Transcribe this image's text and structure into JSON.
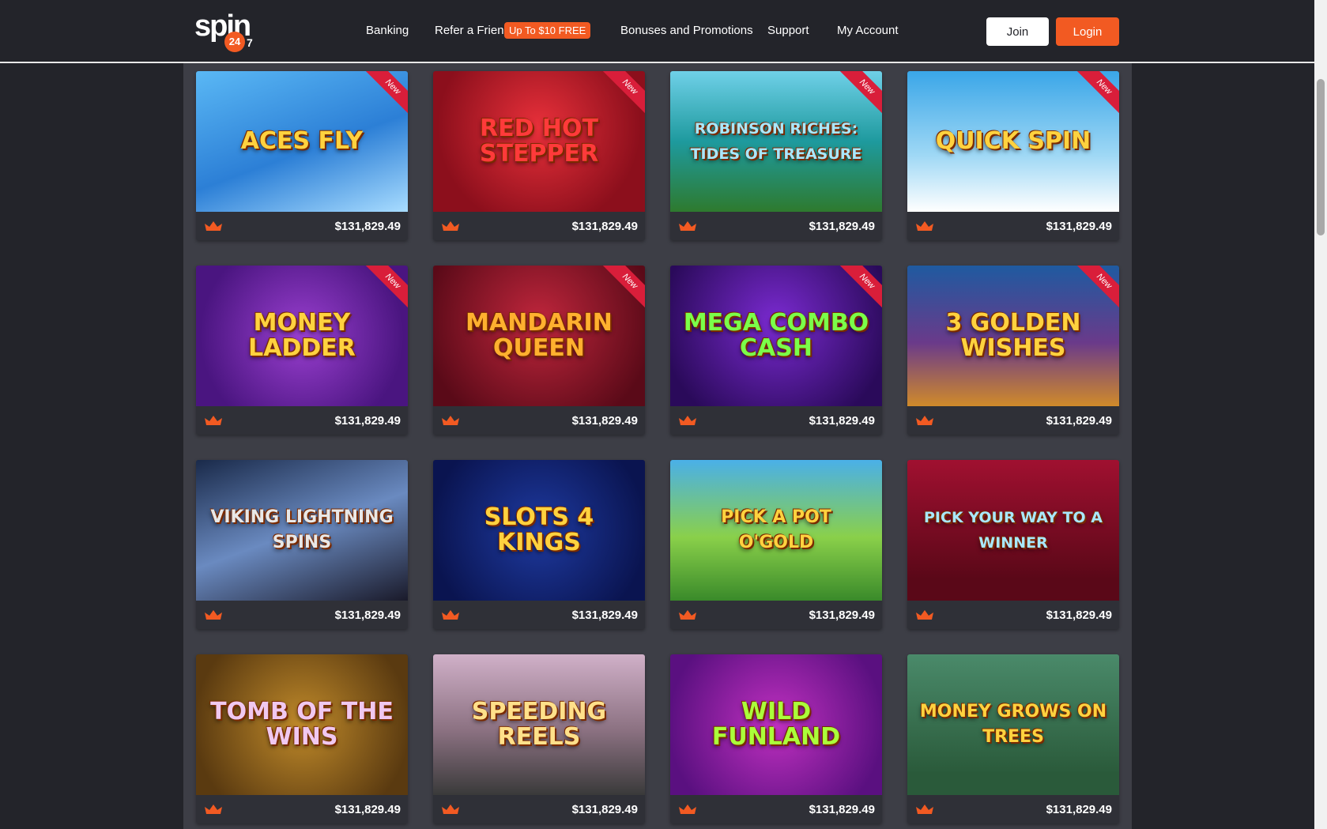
{
  "header": {
    "logo_text": "spin",
    "logo_badge": "24",
    "logo_suffix": "7",
    "nav": {
      "banking": "Banking",
      "refer": "Refer a Friend",
      "refer_promo": "Up To $10 FREE",
      "bonuses": "Bonuses and Promotions",
      "support": "Support",
      "account": "My Account"
    },
    "join_label": "Join",
    "login_label": "Login"
  },
  "colors": {
    "accent": "#f25a22",
    "background": "#23242a",
    "panel": "#3d3e46",
    "ribbon": "#d91e3a"
  },
  "games": [
    {
      "title": "ACES FLY",
      "jackpot": "$131,829.49",
      "badge": "New",
      "icon": "crown-icon"
    },
    {
      "title": "RED HOT STEPPER",
      "jackpot": "$131,829.49",
      "badge": "New",
      "icon": "crown-icon"
    },
    {
      "title": "ROBINSON RICHES: TIDES OF TREASURE",
      "jackpot": "$131,829.49",
      "badge": "New",
      "icon": "crown-icon"
    },
    {
      "title": "QUICK SPIN",
      "jackpot": "$131,829.49",
      "badge": "New",
      "icon": "crown-icon"
    },
    {
      "title": "MONEY LADDER",
      "jackpot": "$131,829.49",
      "badge": "New",
      "icon": "crown-icon"
    },
    {
      "title": "MANDARIN QUEEN",
      "jackpot": "$131,829.49",
      "badge": "New",
      "icon": "crown-icon"
    },
    {
      "title": "MEGA COMBO CASH",
      "jackpot": "$131,829.49",
      "badge": "New",
      "icon": "crown-icon"
    },
    {
      "title": "3 GOLDEN WISHES",
      "jackpot": "$131,829.49",
      "badge": "New",
      "icon": "crown-icon"
    },
    {
      "title": "VIKING LIGHTNING SPINS",
      "jackpot": "$131,829.49",
      "badge": "",
      "icon": "crown-icon"
    },
    {
      "title": "SLOTS 4 KINGS",
      "jackpot": "$131,829.49",
      "badge": "",
      "icon": "crown-icon"
    },
    {
      "title": "PICK A POT O'GOLD",
      "jackpot": "$131,829.49",
      "badge": "",
      "icon": "crown-icon"
    },
    {
      "title": "PICK YOUR WAY TO A WINNER",
      "jackpot": "$131,829.49",
      "badge": "",
      "icon": "crown-icon"
    },
    {
      "title": "TOMB OF THE WINS",
      "jackpot": "$131,829.49",
      "badge": "",
      "icon": "crown-icon"
    },
    {
      "title": "SPEEDING REELS",
      "jackpot": "$131,829.49",
      "badge": "",
      "icon": "crown-icon"
    },
    {
      "title": "WILD FUNLAND",
      "jackpot": "$131,829.49",
      "badge": "",
      "icon": "crown-icon"
    },
    {
      "title": "MONEY GROWS ON TREES",
      "jackpot": "$131,829.49",
      "badge": "",
      "icon": "crown-icon"
    }
  ]
}
